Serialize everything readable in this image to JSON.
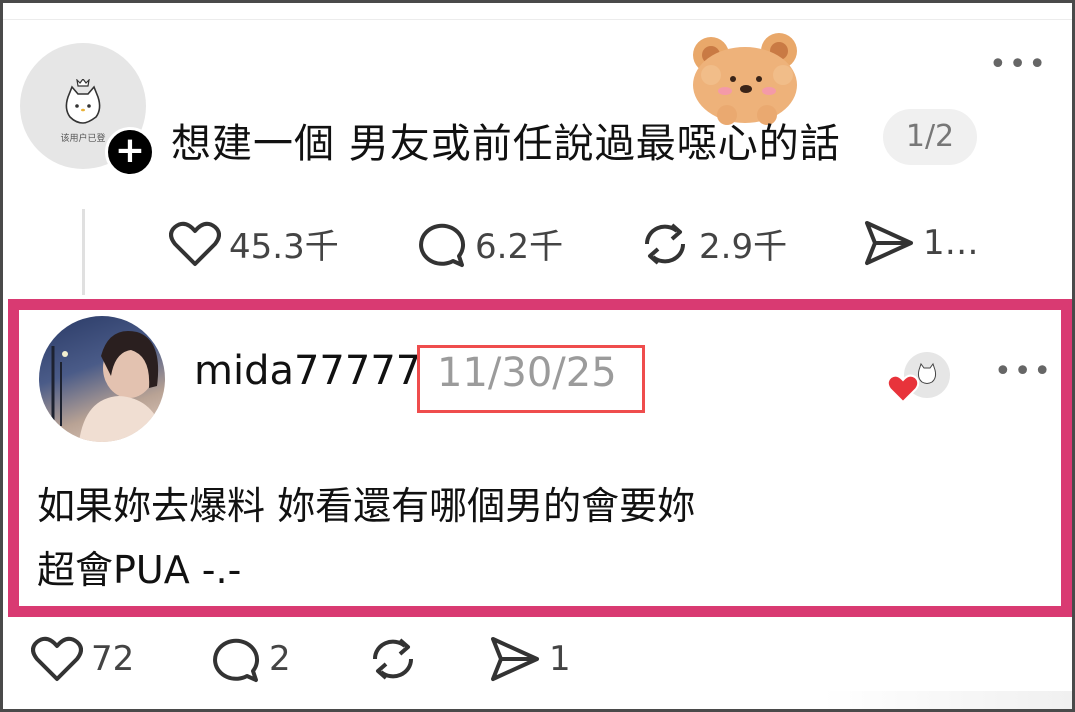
{
  "post": {
    "avatar_caption": "该用户已登",
    "follow_symbol": "+",
    "title": "想建一個 男友或前任說過最噁心的話",
    "page_indicator": "1/2",
    "more_symbol": "•••",
    "actions": {
      "likes": "45.3千",
      "comments": "6.2千",
      "reposts": "2.9千",
      "shares": "1…"
    }
  },
  "reply": {
    "username": "mida77777",
    "date": "11/30/25",
    "more_symbol": "•••",
    "text_lines": [
      "如果妳去爆料 妳看還有哪個男的會要妳",
      "超會PUA -.-"
    ],
    "actions": {
      "likes": "72",
      "comments": "2",
      "shares": "1"
    }
  },
  "colors": {
    "highlight_border": "#d93a72",
    "date_box_border": "#ef4d4d",
    "heart_red": "#e8333b"
  },
  "icons": [
    "heart-icon",
    "comment-icon",
    "repost-icon",
    "share-icon",
    "more-icon",
    "plus-icon",
    "bear-sticker-icon"
  ]
}
